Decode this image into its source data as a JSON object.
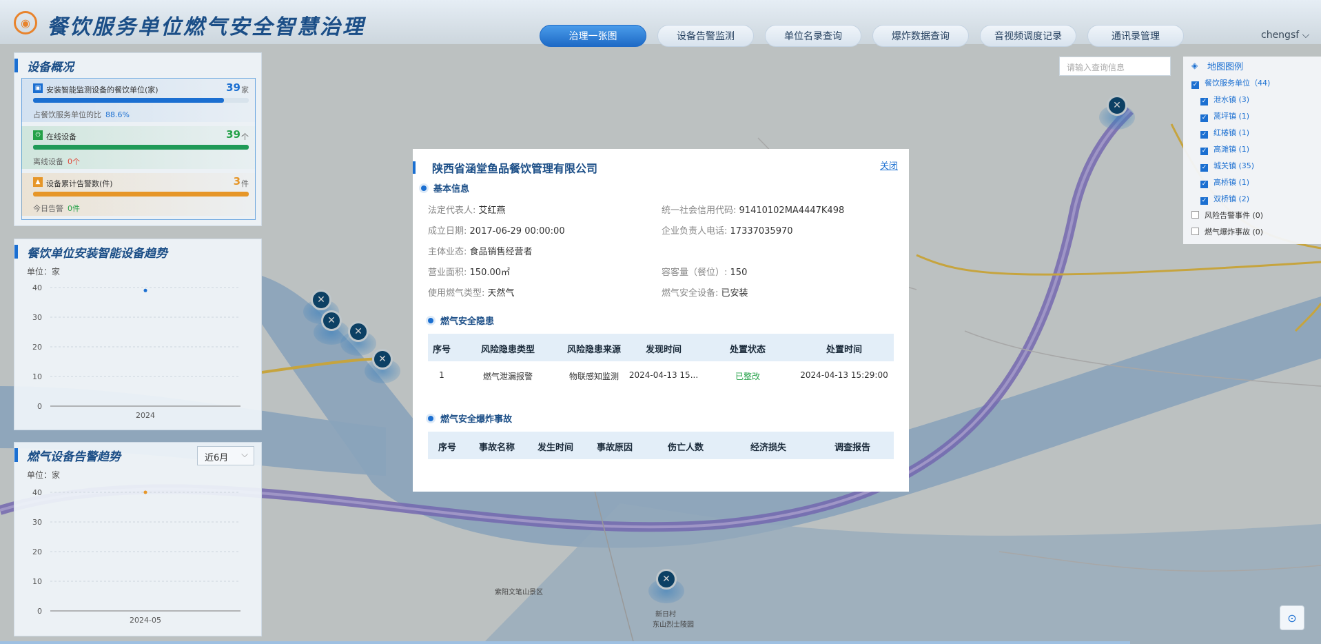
{
  "app_title": "餐饮服务单位燃气安全智慧治理",
  "nav": [
    "治理一张图",
    "设备告警监测",
    "单位名录查询",
    "爆炸数据查询",
    "音视频调度记录",
    "通讯录管理"
  ],
  "user": "chengsf",
  "overview": {
    "title": "设备概况",
    "s1": {
      "label": "安装智能监测设备的餐饮单位(家)",
      "value": "39",
      "unit": "家",
      "sub_label": "占餐饮服务单位的比",
      "sub_value": "88.6%",
      "progress": 0.886
    },
    "s2": {
      "label": "在线设备",
      "value": "39",
      "unit": "个",
      "sub_label": "离线设备",
      "sub_value": "0个",
      "progress": 1.0
    },
    "s3": {
      "label": "设备累计告警数(件)",
      "value": "3",
      "unit": "件",
      "sub_label": "今日告警",
      "sub_value": "0件",
      "progress": 1.0
    }
  },
  "trend1": {
    "title": "餐饮单位安装智能设备趋势",
    "unit": "单位：家",
    "chart_data": {
      "type": "line",
      "categories": [
        "2024"
      ],
      "series": [
        {
          "values": [
            39
          ]
        }
      ],
      "ylim": [
        0,
        40
      ],
      "yticks": [
        "40",
        "30",
        "20",
        "10",
        "0"
      ]
    }
  },
  "trend2": {
    "title": "燃气设备告警趋势",
    "select": "近6月",
    "unit": "单位：家",
    "chart_data": {
      "type": "line",
      "categories": [
        "2024-05"
      ],
      "series": [
        {
          "values": [
            40
          ]
        }
      ],
      "ylim": [
        0,
        40
      ],
      "yticks": [
        "40",
        "30",
        "20",
        "10",
        "0"
      ]
    }
  },
  "search": {
    "placeholder": "请输入查询信息"
  },
  "legend": {
    "title": "地图图例",
    "items": [
      {
        "label": "餐饮服务单位（44)",
        "checked": true
      },
      {
        "label": "泄水镇 (3)",
        "checked": true
      },
      {
        "label": "蒿坪镇 (1)",
        "checked": true
      },
      {
        "label": "红椿镇 (1)",
        "checked": true
      },
      {
        "label": "高滩镇 (1)",
        "checked": true
      },
      {
        "label": "城关镇 (35)",
        "checked": true
      },
      {
        "label": "高桥镇 (1)",
        "checked": true
      },
      {
        "label": "双桥镇 (2)",
        "checked": true
      },
      {
        "label": "风险告警事件 (0)",
        "checked": false
      },
      {
        "label": "燃气爆炸事故 (0)",
        "checked": false
      }
    ]
  },
  "map_labels": {
    "village": "新日村",
    "cemetery": "东山烈士陵园",
    "scenic": "紫阳文笔山景区"
  },
  "modal": {
    "title": "陕西省涵堂鱼品餐饮管理有限公司",
    "close": "关闭",
    "basic_title": "基本信息",
    "fields": [
      {
        "label": "法定代表人:",
        "value": "艾红燕"
      },
      {
        "label": "统一社会信用代码:",
        "value": "91410102MA4447K498"
      },
      {
        "label": "成立日期:",
        "value": "2017-06-29 00:00:00"
      },
      {
        "label": "企业负责人电话:",
        "value": "17337035970"
      },
      {
        "label": "主体业态:",
        "value": "食品销售经营者"
      },
      {
        "label": "营业面积:",
        "value": "150.00㎡"
      },
      {
        "label": "容客量（餐位）:",
        "value": "150"
      },
      {
        "label": "使用燃气类型:",
        "value": "天然气"
      },
      {
        "label": "燃气安全设备:",
        "value": "已安装"
      }
    ],
    "hazard_title": "燃气安全隐患",
    "hazard_headers": [
      "序号",
      "风险隐患类型",
      "风险隐患来源",
      "发现时间",
      "处置状态",
      "处置时间"
    ],
    "hazard_rows": [
      [
        "1",
        "燃气泄漏报警",
        "物联感知监测",
        "2024-04-13 15...",
        "已整改",
        "2024-04-13 15:29:00"
      ]
    ],
    "accident_title": "燃气安全爆炸事故",
    "accident_headers": [
      "序号",
      "事故名称",
      "发生时间",
      "事故原因",
      "伤亡人数",
      "经济损失",
      "调查报告"
    ]
  }
}
